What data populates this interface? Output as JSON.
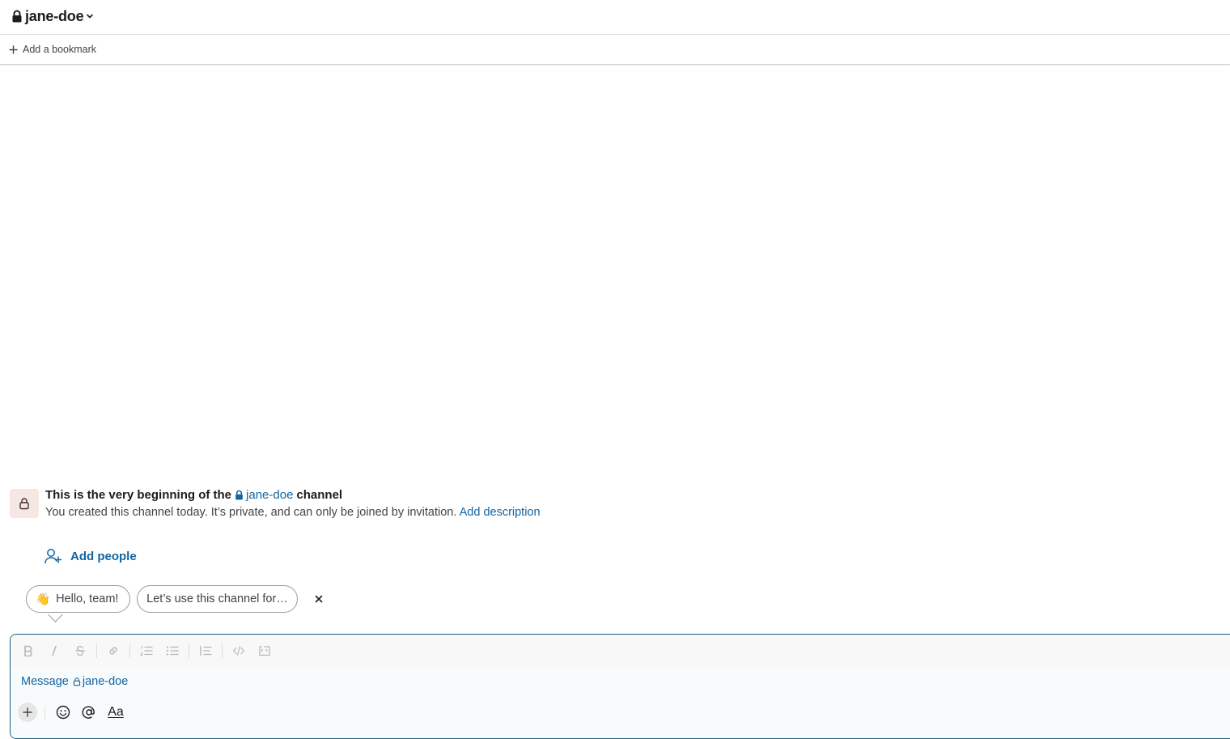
{
  "header": {
    "channel_name": "jane-doe"
  },
  "bookmarks": {
    "add_label": "Add a bookmark"
  },
  "intro": {
    "title_prefix": "This is the very beginning of the",
    "channel_name": "jane-doe",
    "title_suffix": "channel",
    "description": "You created this channel today. It’s private, and can only be joined by invitation.",
    "add_description_label": "Add description",
    "add_people_label": "Add people"
  },
  "suggestions": {
    "items": [
      {
        "emoji": "👋",
        "label": "Hello, team!"
      },
      {
        "label": "Let’s use this channel for…"
      }
    ],
    "close_label": "×"
  },
  "composer": {
    "placeholder_prefix": "Message",
    "placeholder_channel": "jane-doe",
    "format_label": "Aa"
  },
  "colors": {
    "link": "#1264a3",
    "composer_border": "#1d5e83",
    "lock_box_bg": "#f3e9e2"
  }
}
